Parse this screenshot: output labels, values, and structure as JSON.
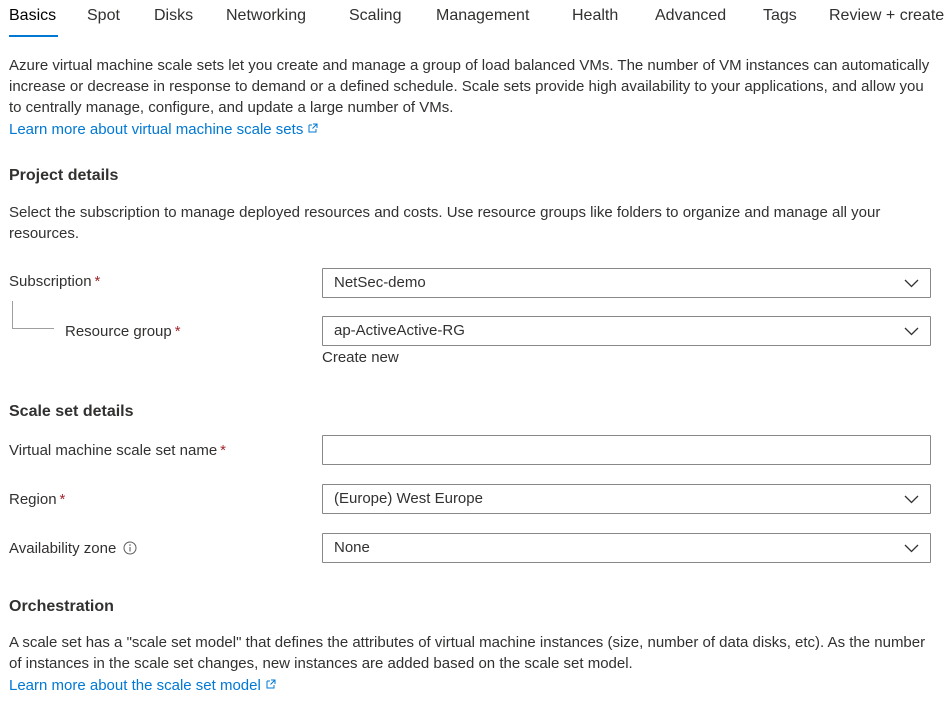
{
  "tabs": [
    {
      "label": "Basics",
      "active": true
    },
    {
      "label": "Spot"
    },
    {
      "label": "Disks"
    },
    {
      "label": "Networking"
    },
    {
      "label": "Scaling"
    },
    {
      "label": "Management"
    },
    {
      "label": "Health"
    },
    {
      "label": "Advanced"
    },
    {
      "label": "Tags"
    },
    {
      "label": "Review + create"
    }
  ],
  "intro": {
    "text": "Azure virtual machine scale sets let you create and manage a group of load balanced VMs. The number of VM instances can automatically increase or decrease in response to demand or a defined schedule. Scale sets provide high availability to your applications, and allow you to centrally manage, configure, and update a large number of VMs.",
    "link": "Learn more about virtual machine scale sets"
  },
  "project": {
    "heading": "Project details",
    "description": "Select the subscription to manage deployed resources and costs. Use resource groups like folders to organize and manage all your resources.",
    "subscription_label": "Subscription",
    "subscription_value": "NetSec-demo",
    "resource_group_label": "Resource group",
    "resource_group_value": "ap-ActiveActive-RG",
    "create_new": "Create new"
  },
  "scale_set": {
    "heading": "Scale set details",
    "name_label": "Virtual machine scale set name",
    "name_value": "",
    "region_label": "Region",
    "region_value": "(Europe) West Europe",
    "zone_label": "Availability zone",
    "zone_value": "None"
  },
  "orchestration": {
    "heading": "Orchestration",
    "text": "A scale set has a \"scale set model\" that defines the attributes of virtual machine instances (size, number of data disks, etc). As the number of instances in the scale set changes, new instances are added based on the scale set model.",
    "link": "Learn more about the scale set model"
  },
  "required_mark": "*",
  "colors": {
    "accent": "#0078d4",
    "required": "#a4262c",
    "border": "#8a8886",
    "text": "#323130"
  }
}
